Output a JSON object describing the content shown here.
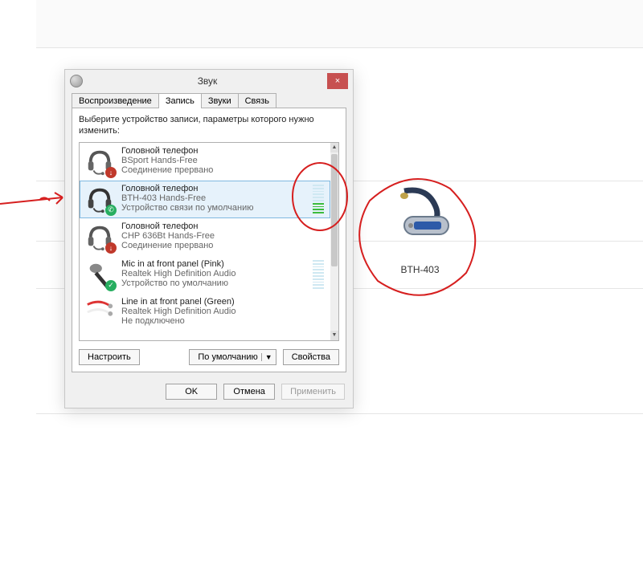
{
  "dialog": {
    "title": "Звук",
    "close": "×",
    "tabs": [
      {
        "label": "Воспроизведение",
        "active": false
      },
      {
        "label": "Запись",
        "active": true
      },
      {
        "label": "Звуки",
        "active": false
      },
      {
        "label": "Связь",
        "active": false
      }
    ],
    "instruction": "Выберите устройство записи, параметры которого нужно изменить:",
    "devices": [
      {
        "name": "Головной телефон",
        "sub1": "BSport Hands-Free",
        "sub2": "Соединение прервано",
        "icon": "headset",
        "badge": "down",
        "selected": false,
        "meter": 0
      },
      {
        "name": "Головной телефон",
        "sub1": "BTH-403 Hands-Free",
        "sub2": "Устройство связи по умолчанию",
        "icon": "headset",
        "badge": "phone",
        "selected": true,
        "meter": 4
      },
      {
        "name": "Головной телефон",
        "sub1": "CHP 636Bt Hands-Free",
        "sub2": "Соединение прервано",
        "icon": "headset",
        "badge": "down",
        "selected": false,
        "meter": 0
      },
      {
        "name": "Mic in at front panel (Pink)",
        "sub1": "Realtek High Definition Audio",
        "sub2": "Устройство по умолчанию",
        "icon": "mic",
        "badge": "check",
        "selected": false,
        "meter": 0
      },
      {
        "name": "Line in at front panel (Green)",
        "sub1": "Realtek High Definition Audio",
        "sub2": "Не подключено",
        "icon": "linein",
        "badge": "",
        "selected": false,
        "meter": 0
      }
    ],
    "buttons": {
      "configure": "Настроить",
      "default": "По умолчанию",
      "properties": "Свойства",
      "ok": "OK",
      "cancel": "Отмена",
      "apply": "Применить"
    }
  },
  "external": {
    "label": "BTH-403"
  }
}
